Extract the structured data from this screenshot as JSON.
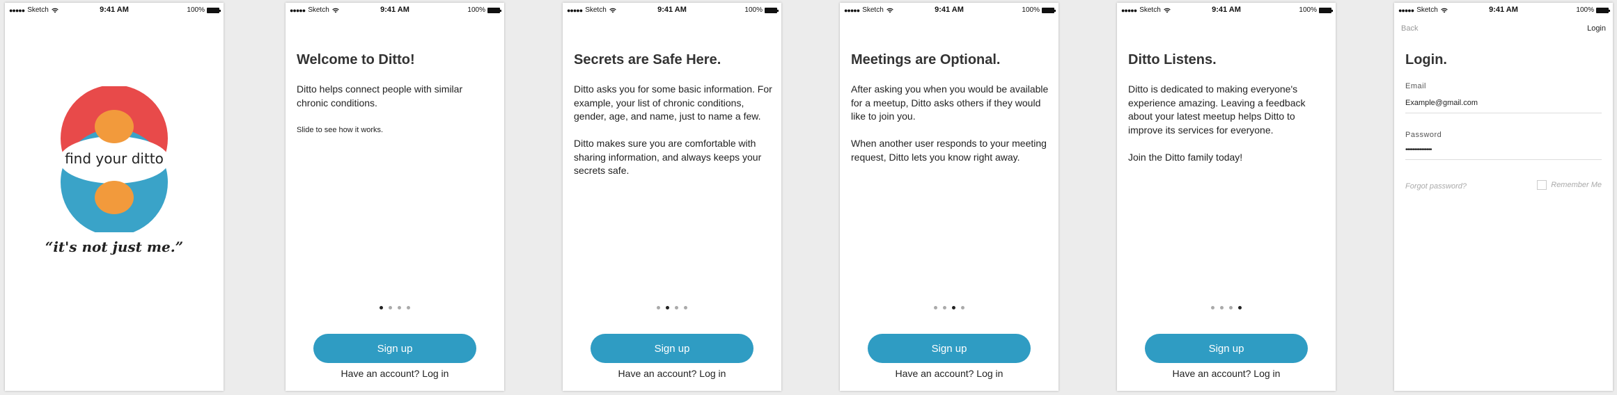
{
  "status_bar": {
    "carrier": "Sketch",
    "time": "9:41 AM",
    "battery": "100%"
  },
  "splash": {
    "logo_text": "find your ditto",
    "tagline": "“it's not just me.”",
    "colors": {
      "top": "#e84a4a",
      "bottom": "#3aa3c8",
      "accent": "#f29a3c"
    }
  },
  "onboarding": [
    {
      "title": "Welcome to Ditto!",
      "paragraphs": [
        "Ditto helps connect people with similar chronic conditions."
      ],
      "note": "Slide to see how it works.",
      "active_dot": 0
    },
    {
      "title": "Secrets are Safe Here.",
      "paragraphs": [
        "Ditto asks you for some basic information. For example, your list of chronic conditions, gender, age, and name, just to name a few.",
        "Ditto makes sure you are comfortable with sharing information, and always keeps your secrets safe."
      ],
      "active_dot": 1
    },
    {
      "title": "Meetings are Optional.",
      "paragraphs": [
        "After asking you when you would be available for a meetup, Ditto asks others if they would like to join you.",
        "When another user responds to your meeting request, Ditto lets you know right away."
      ],
      "active_dot": 2
    },
    {
      "title": "Ditto Listens.",
      "paragraphs": [
        "Ditto is dedicated to making everyone's experience amazing. Leaving a feedback about your latest meetup helps Ditto to improve its services for everyone.",
        "Join the Ditto family today!"
      ],
      "active_dot": 3
    }
  ],
  "signup_label": "Sign up",
  "account_prompt": "Have an account?",
  "login_link": "Log in",
  "login": {
    "back": "Back",
    "nav_login": "Login",
    "title": "Login.",
    "email_label": "Email",
    "email_value": "Example@gmail.com",
    "password_label": "Password",
    "password_value": "•••••••••••••••",
    "forgot": "Forgot password?",
    "remember": "Remember Me"
  },
  "accent_color": "#2f9cc3"
}
